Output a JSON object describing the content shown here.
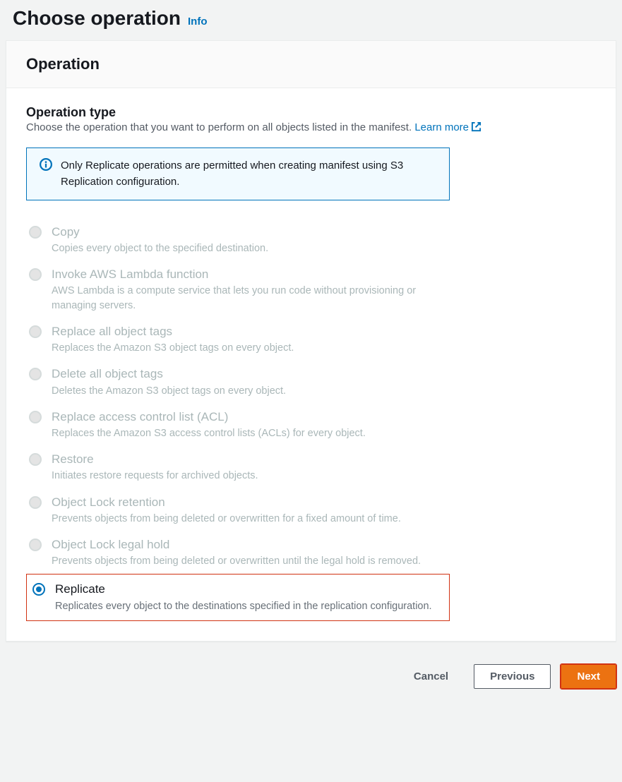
{
  "header": {
    "title": "Choose operation",
    "info_label": "Info"
  },
  "panel": {
    "heading": "Operation",
    "section_label": "Operation type",
    "section_desc": "Choose the operation that you want to perform on all objects listed in the manifest. ",
    "learn_more": "Learn more",
    "info_box": "Only Replicate operations are permitted when creating manifest using S3 Replication configuration."
  },
  "options": [
    {
      "id": "copy",
      "title": "Copy",
      "desc": "Copies every object to the specified destination.",
      "disabled": true,
      "selected": false
    },
    {
      "id": "lambda",
      "title": "Invoke AWS Lambda function",
      "desc": "AWS Lambda is a compute service that lets you run code without provisioning or managing servers.",
      "disabled": true,
      "selected": false
    },
    {
      "id": "replace-tags",
      "title": "Replace all object tags",
      "desc": "Replaces the Amazon S3 object tags on every object.",
      "disabled": true,
      "selected": false
    },
    {
      "id": "delete-tags",
      "title": "Delete all object tags",
      "desc": "Deletes the Amazon S3 object tags on every object.",
      "disabled": true,
      "selected": false
    },
    {
      "id": "replace-acl",
      "title": "Replace access control list (ACL)",
      "desc": "Replaces the Amazon S3 access control lists (ACLs) for every object.",
      "disabled": true,
      "selected": false
    },
    {
      "id": "restore",
      "title": "Restore",
      "desc": "Initiates restore requests for archived objects.",
      "disabled": true,
      "selected": false
    },
    {
      "id": "lock-retention",
      "title": "Object Lock retention",
      "desc": "Prevents objects from being deleted or overwritten for a fixed amount of time.",
      "disabled": true,
      "selected": false
    },
    {
      "id": "lock-legal",
      "title": "Object Lock legal hold",
      "desc": "Prevents objects from being deleted or overwritten until the legal hold is removed.",
      "disabled": true,
      "selected": false
    },
    {
      "id": "replicate",
      "title": "Replicate",
      "desc": "Replicates every object to the destinations specified in the replication configuration.",
      "disabled": false,
      "selected": true
    }
  ],
  "footer": {
    "cancel": "Cancel",
    "previous": "Previous",
    "next": "Next"
  }
}
